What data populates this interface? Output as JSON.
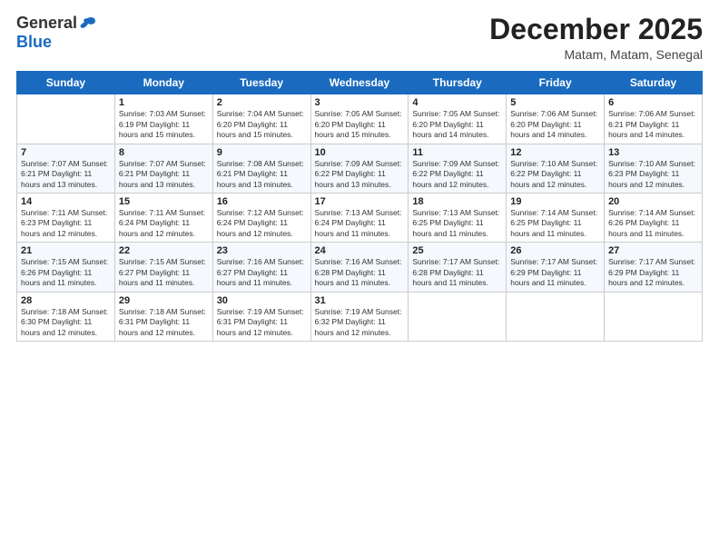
{
  "logo": {
    "general": "General",
    "blue": "Blue"
  },
  "title": {
    "month_year": "December 2025",
    "location": "Matam, Matam, Senegal"
  },
  "days_header": [
    "Sunday",
    "Monday",
    "Tuesday",
    "Wednesday",
    "Thursday",
    "Friday",
    "Saturday"
  ],
  "weeks": [
    [
      {
        "day": "",
        "info": ""
      },
      {
        "day": "1",
        "info": "Sunrise: 7:03 AM\nSunset: 6:19 PM\nDaylight: 11 hours\nand 15 minutes."
      },
      {
        "day": "2",
        "info": "Sunrise: 7:04 AM\nSunset: 6:20 PM\nDaylight: 11 hours\nand 15 minutes."
      },
      {
        "day": "3",
        "info": "Sunrise: 7:05 AM\nSunset: 6:20 PM\nDaylight: 11 hours\nand 15 minutes."
      },
      {
        "day": "4",
        "info": "Sunrise: 7:05 AM\nSunset: 6:20 PM\nDaylight: 11 hours\nand 14 minutes."
      },
      {
        "day": "5",
        "info": "Sunrise: 7:06 AM\nSunset: 6:20 PM\nDaylight: 11 hours\nand 14 minutes."
      },
      {
        "day": "6",
        "info": "Sunrise: 7:06 AM\nSunset: 6:21 PM\nDaylight: 11 hours\nand 14 minutes."
      }
    ],
    [
      {
        "day": "7",
        "info": "Sunrise: 7:07 AM\nSunset: 6:21 PM\nDaylight: 11 hours\nand 13 minutes."
      },
      {
        "day": "8",
        "info": "Sunrise: 7:07 AM\nSunset: 6:21 PM\nDaylight: 11 hours\nand 13 minutes."
      },
      {
        "day": "9",
        "info": "Sunrise: 7:08 AM\nSunset: 6:21 PM\nDaylight: 11 hours\nand 13 minutes."
      },
      {
        "day": "10",
        "info": "Sunrise: 7:09 AM\nSunset: 6:22 PM\nDaylight: 11 hours\nand 13 minutes."
      },
      {
        "day": "11",
        "info": "Sunrise: 7:09 AM\nSunset: 6:22 PM\nDaylight: 11 hours\nand 12 minutes."
      },
      {
        "day": "12",
        "info": "Sunrise: 7:10 AM\nSunset: 6:22 PM\nDaylight: 11 hours\nand 12 minutes."
      },
      {
        "day": "13",
        "info": "Sunrise: 7:10 AM\nSunset: 6:23 PM\nDaylight: 11 hours\nand 12 minutes."
      }
    ],
    [
      {
        "day": "14",
        "info": "Sunrise: 7:11 AM\nSunset: 6:23 PM\nDaylight: 11 hours\nand 12 minutes."
      },
      {
        "day": "15",
        "info": "Sunrise: 7:11 AM\nSunset: 6:24 PM\nDaylight: 11 hours\nand 12 minutes."
      },
      {
        "day": "16",
        "info": "Sunrise: 7:12 AM\nSunset: 6:24 PM\nDaylight: 11 hours\nand 12 minutes."
      },
      {
        "day": "17",
        "info": "Sunrise: 7:13 AM\nSunset: 6:24 PM\nDaylight: 11 hours\nand 11 minutes."
      },
      {
        "day": "18",
        "info": "Sunrise: 7:13 AM\nSunset: 6:25 PM\nDaylight: 11 hours\nand 11 minutes."
      },
      {
        "day": "19",
        "info": "Sunrise: 7:14 AM\nSunset: 6:25 PM\nDaylight: 11 hours\nand 11 minutes."
      },
      {
        "day": "20",
        "info": "Sunrise: 7:14 AM\nSunset: 6:26 PM\nDaylight: 11 hours\nand 11 minutes."
      }
    ],
    [
      {
        "day": "21",
        "info": "Sunrise: 7:15 AM\nSunset: 6:26 PM\nDaylight: 11 hours\nand 11 minutes."
      },
      {
        "day": "22",
        "info": "Sunrise: 7:15 AM\nSunset: 6:27 PM\nDaylight: 11 hours\nand 11 minutes."
      },
      {
        "day": "23",
        "info": "Sunrise: 7:16 AM\nSunset: 6:27 PM\nDaylight: 11 hours\nand 11 minutes."
      },
      {
        "day": "24",
        "info": "Sunrise: 7:16 AM\nSunset: 6:28 PM\nDaylight: 11 hours\nand 11 minutes."
      },
      {
        "day": "25",
        "info": "Sunrise: 7:17 AM\nSunset: 6:28 PM\nDaylight: 11 hours\nand 11 minutes."
      },
      {
        "day": "26",
        "info": "Sunrise: 7:17 AM\nSunset: 6:29 PM\nDaylight: 11 hours\nand 11 minutes."
      },
      {
        "day": "27",
        "info": "Sunrise: 7:17 AM\nSunset: 6:29 PM\nDaylight: 11 hours\nand 12 minutes."
      }
    ],
    [
      {
        "day": "28",
        "info": "Sunrise: 7:18 AM\nSunset: 6:30 PM\nDaylight: 11 hours\nand 12 minutes."
      },
      {
        "day": "29",
        "info": "Sunrise: 7:18 AM\nSunset: 6:31 PM\nDaylight: 11 hours\nand 12 minutes."
      },
      {
        "day": "30",
        "info": "Sunrise: 7:19 AM\nSunset: 6:31 PM\nDaylight: 11 hours\nand 12 minutes."
      },
      {
        "day": "31",
        "info": "Sunrise: 7:19 AM\nSunset: 6:32 PM\nDaylight: 11 hours\nand 12 minutes."
      },
      {
        "day": "",
        "info": ""
      },
      {
        "day": "",
        "info": ""
      },
      {
        "day": "",
        "info": ""
      }
    ]
  ]
}
